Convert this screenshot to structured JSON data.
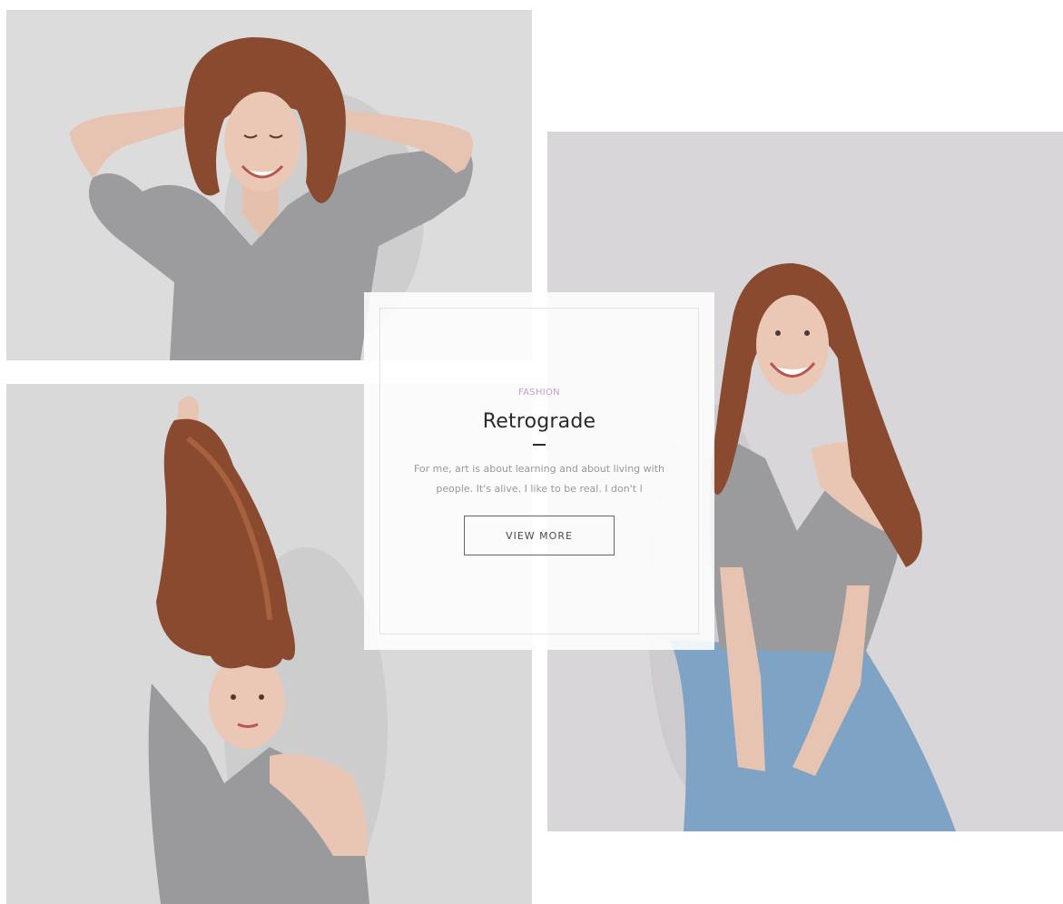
{
  "gallery": {
    "photos": [
      {
        "name": "woman-hands-on-head-laughing"
      },
      {
        "name": "woman-holding-hair-up"
      },
      {
        "name": "woman-smiling-jeans"
      }
    ]
  },
  "card": {
    "category": "FASHION",
    "title": "Retrograde",
    "excerpt": "For me, art is about learning and about living with people. It's alive. I like to be real. I don't l",
    "button_label": "VIEW MORE"
  },
  "colors": {
    "accent": "#c59bd1",
    "title": "#2a2a2a",
    "text": "#9a979c",
    "button_border": "#6c6070",
    "photo_background": "#dcdbdc",
    "hair": "#8a4a30",
    "sweater": "#9a9a9c",
    "skin": "#e9c6b4",
    "jeans": "#7ea3c4"
  }
}
